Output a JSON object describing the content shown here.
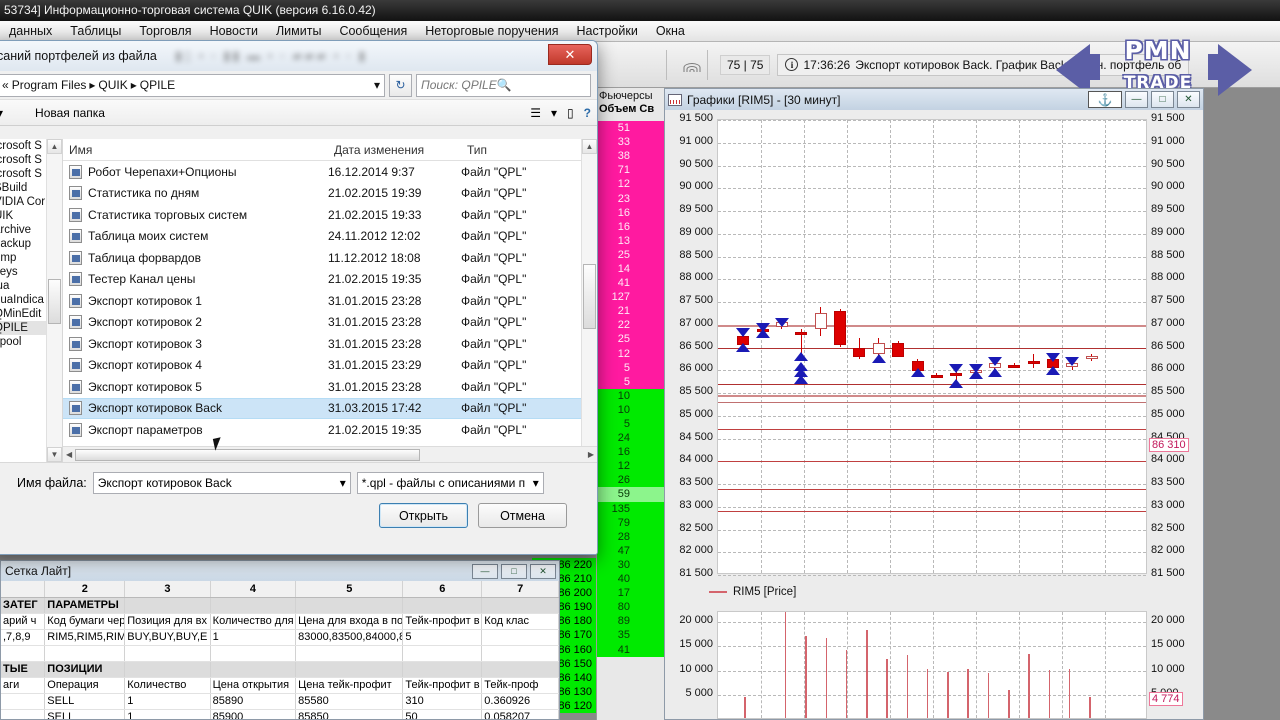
{
  "quik": {
    "title": "53734] Информационно-торговая система QUIK (версия 6.16.0.42)",
    "menu": [
      "данных",
      "Таблицы",
      "Торговля",
      "Новости",
      "Лимиты",
      "Сообщения",
      "Неторговые поручения",
      "Настройки",
      "Окна"
    ],
    "toolbar": {
      "counter": "75 | 75",
      "status_time": "17:36:26",
      "status_message": "Экспорт котировок Back. График Back",
      "status_tail": "тупен. портфель об",
      "wifi_icon": "signal-icon",
      "info_icon": "info-icon"
    }
  },
  "watermark": {
    "line1": "PMN",
    "line2": "TRADE"
  },
  "orderbook": {
    "title": "Фьючерсы",
    "headers": [
      "Объем",
      "Св"
    ],
    "sell_volumes": [
      51,
      33,
      38,
      71,
      12,
      23,
      16,
      16,
      13,
      25,
      14,
      41,
      127,
      21,
      22,
      25,
      12,
      5,
      5
    ],
    "buy_volumes": [
      10,
      10,
      5,
      24,
      16,
      12,
      26,
      59,
      135,
      79,
      28,
      47,
      30,
      40,
      17,
      80,
      89,
      35,
      41
    ],
    "buy_prices": [
      "86 220",
      "86 210",
      "86 200",
      "86 190",
      "86 180",
      "86 170",
      "86 160",
      "86 150",
      "86 140",
      "86 130",
      "86 120"
    ],
    "highlight_index": 7
  },
  "charts": {
    "title": "Графики [RIM5] - [30 минут]",
    "window_icon": "chart-icon",
    "anchor_icon": "anchor-icon",
    "buttons": {
      "minimize": "—",
      "maximize": "□",
      "close": "✕"
    },
    "legend": "RIM5 [Price]",
    "legend_color": "#d4646c",
    "price_marker": "86 310",
    "volume_marker": "4 774"
  },
  "chart_data": {
    "type": "candlestick",
    "title": "Графики [RIM5] - [30 минут]",
    "series_name": "RIM5 [Price]",
    "ylabel": "",
    "xlabel": "",
    "ylim": [
      81500,
      91500
    ],
    "ytick_step": 500,
    "yticks": [
      "91 500",
      "91 000",
      "90 500",
      "90 000",
      "89 500",
      "89 000",
      "88 500",
      "88 000",
      "87 500",
      "87 000",
      "86 500",
      "86 000",
      "85 500",
      "85 000",
      "84 500",
      "84 000",
      "83 500",
      "83 000",
      "82 500",
      "82 000",
      "81 500"
    ],
    "grid": true,
    "last_price": 86310,
    "candles": [
      {
        "open": 86550,
        "close": 86750,
        "high": 86850,
        "low": 86500,
        "dir": "down",
        "marker_down": true,
        "marker_up": true
      },
      {
        "open": 86900,
        "close": 86850,
        "high": 86950,
        "low": 86800,
        "dir": "down",
        "marker_down": true,
        "marker_up": true
      },
      {
        "open": 86950,
        "close": 87050,
        "high": 87050,
        "low": 86900,
        "dir": "up",
        "marker_down": true
      },
      {
        "open": 86850,
        "close": 86800,
        "high": 86900,
        "low": 86300,
        "dir": "down",
        "marker_up": true
      },
      {
        "open": 87250,
        "close": 86900,
        "high": 87400,
        "low": 86750,
        "dir": "up"
      },
      {
        "open": 87300,
        "close": 86550,
        "high": 87350,
        "low": 86500,
        "dir": "down"
      },
      {
        "open": 86500,
        "close": 86300,
        "high": 86700,
        "low": 86250,
        "dir": "down"
      },
      {
        "open": 86600,
        "close": 86350,
        "high": 86700,
        "low": 86250,
        "dir": "up",
        "marker_up": true
      },
      {
        "open": 86600,
        "close": 86300,
        "high": 86650,
        "low": 86300,
        "dir": "down"
      },
      {
        "open": 86200,
        "close": 85980,
        "high": 86250,
        "low": 85950,
        "dir": "down",
        "marker_up": true
      },
      {
        "open": 85900,
        "close": 85900,
        "high": 85950,
        "low": 85880,
        "dir": "down"
      },
      {
        "open": 85950,
        "close": 85950,
        "high": 86050,
        "low": 85700,
        "dir": "down",
        "marker_down": true,
        "marker_up": true
      },
      {
        "open": 86000,
        "close": 85950,
        "high": 86050,
        "low": 85900,
        "dir": "up",
        "marker_down": true,
        "marker_up": true
      },
      {
        "open": 86150,
        "close": 86050,
        "high": 86200,
        "low": 85950,
        "dir": "up",
        "marker_down": true,
        "marker_up": true
      },
      {
        "open": 86120,
        "close": 86100,
        "high": 86150,
        "low": 86050,
        "dir": "down"
      },
      {
        "open": 86200,
        "close": 86180,
        "high": 86350,
        "low": 86050,
        "dir": "down"
      },
      {
        "open": 86250,
        "close": 86050,
        "high": 86300,
        "low": 85980,
        "dir": "down",
        "marker_down": true,
        "marker_up": true
      },
      {
        "open": 86150,
        "close": 86080,
        "high": 86200,
        "low": 86000,
        "dir": "up",
        "marker_down": true
      },
      {
        "open": 86310,
        "close": 86250,
        "high": 86350,
        "low": 86200,
        "dir": "up"
      }
    ],
    "volume": {
      "type": "bar",
      "ylim": [
        0,
        22000
      ],
      "yticks": [
        "20 000",
        "15 000",
        "10 000",
        "5 000"
      ],
      "last_value": 4774,
      "values": [
        4200,
        0,
        21500,
        16800,
        16300,
        13900,
        17900,
        12100,
        12800,
        9900,
        9300,
        9900,
        9100,
        5700,
        13000,
        9700,
        9900,
        4300
      ]
    }
  },
  "grid_window": {
    "title": "Сетка Лайт]",
    "buttons": {
      "minimize": "—",
      "maximize": "□",
      "close": "✕"
    },
    "column_numbers": [
      "",
      "2",
      "3",
      "4",
      "5",
      "6",
      "7"
    ],
    "section1": [
      "ЗАТЕГ",
      "ПАРАМЕТРЫ",
      "",
      "",
      "",
      "",
      ""
    ],
    "headers1": [
      "арий ч",
      "Код бумаги чер",
      "Позиция для вх",
      "Количество для",
      "Цена для входа в по",
      "Тейк-профит в ц",
      "Код клас"
    ],
    "row1": [
      ",7,8,9",
      "RIM5,RIM5,RIM!",
      "BUY,BUY,BUY,E",
      "1",
      "83000,83500,84000,8",
      "5",
      ""
    ],
    "section2": [
      "ТЫЕ",
      "ПОЗИЦИИ",
      "",
      "",
      "",
      "",
      ""
    ],
    "headers2": [
      "аги",
      "Операция",
      "Количество",
      "Цена открытия",
      "Цена тейк-профит",
      "Тейк-профит в г",
      "Тейк-проф"
    ],
    "rows2": [
      [
        "",
        "SELL",
        "1",
        "85890",
        "85580",
        "310",
        "0.360926"
      ],
      [
        "",
        "SELL",
        "1",
        "85900",
        "85850",
        "50",
        "0.058207"
      ]
    ]
  },
  "file_dialog": {
    "title": "саний портфелей из файла",
    "close_label": "✕",
    "breadcrumb": [
      "«",
      "Program Files",
      "QUIK",
      "QPILE"
    ],
    "refresh_icon": "refresh-icon",
    "search_placeholder": "Поиск: QPILE",
    "search_icon": "search-icon",
    "toolbar": {
      "organize_icon": "chevron-down-icon",
      "new_folder": "Новая папка",
      "view_icon": "view-list-icon",
      "pane_icon": "preview-pane-icon",
      "help_icon": "help-icon"
    },
    "tree": [
      {
        "label": "icrosoft S"
      },
      {
        "label": "icrosoft S"
      },
      {
        "label": "icrosoft S"
      },
      {
        "label": "SBuild"
      },
      {
        "label": "VIDIA Cor"
      },
      {
        "label": "UIK"
      },
      {
        "label": "archive"
      },
      {
        "label": "backup"
      },
      {
        "label": "dmp"
      },
      {
        "label": "keys"
      },
      {
        "label": "lua"
      },
      {
        "label": "LuaIndica"
      },
      {
        "label": "QMinEdit"
      },
      {
        "label": "QPILE",
        "selected": true
      },
      {
        "label": "spool"
      }
    ],
    "columns": [
      "Имя",
      "Дата изменения",
      "Тип"
    ],
    "files": [
      {
        "name": "Робот Черепахи+Опционы",
        "date": "16.12.2014 9:37",
        "type": "Файл \"QPL\""
      },
      {
        "name": "Статистика по дням",
        "date": "21.02.2015 19:39",
        "type": "Файл \"QPL\""
      },
      {
        "name": "Статистика торговых систем",
        "date": "21.02.2015 19:33",
        "type": "Файл \"QPL\""
      },
      {
        "name": "Таблица моих систем",
        "date": "24.11.2012 12:02",
        "type": "Файл \"QPL\""
      },
      {
        "name": "Таблица форвардов",
        "date": "11.12.2012 18:08",
        "type": "Файл \"QPL\""
      },
      {
        "name": "Тестер Канал цены",
        "date": "21.02.2015 19:35",
        "type": "Файл \"QPL\""
      },
      {
        "name": "Экспорт котировок 1",
        "date": "31.01.2015 23:28",
        "type": "Файл \"QPL\""
      },
      {
        "name": "Экспорт котировок 2",
        "date": "31.01.2015 23:28",
        "type": "Файл \"QPL\""
      },
      {
        "name": "Экспорт котировок 3",
        "date": "31.01.2015 23:28",
        "type": "Файл \"QPL\""
      },
      {
        "name": "Экспорт котировок 4",
        "date": "31.01.2015 23:29",
        "type": "Файл \"QPL\""
      },
      {
        "name": "Экспорт котировок 5",
        "date": "31.01.2015 23:28",
        "type": "Файл \"QPL\""
      },
      {
        "name": "Экспорт котировок Back",
        "date": "31.03.2015 17:42",
        "type": "Файл \"QPL\"",
        "selected": true
      },
      {
        "name": "Экспорт параметров",
        "date": "21.02.2015 19:35",
        "type": "Файл \"QPL\""
      }
    ],
    "filename_label": "Имя файла:",
    "filename_value": "Экспорт котировок Back",
    "filter_value": "*.qpl - файлы с описаниями п",
    "open_button": "Открыть",
    "cancel_button": "Отмена"
  }
}
